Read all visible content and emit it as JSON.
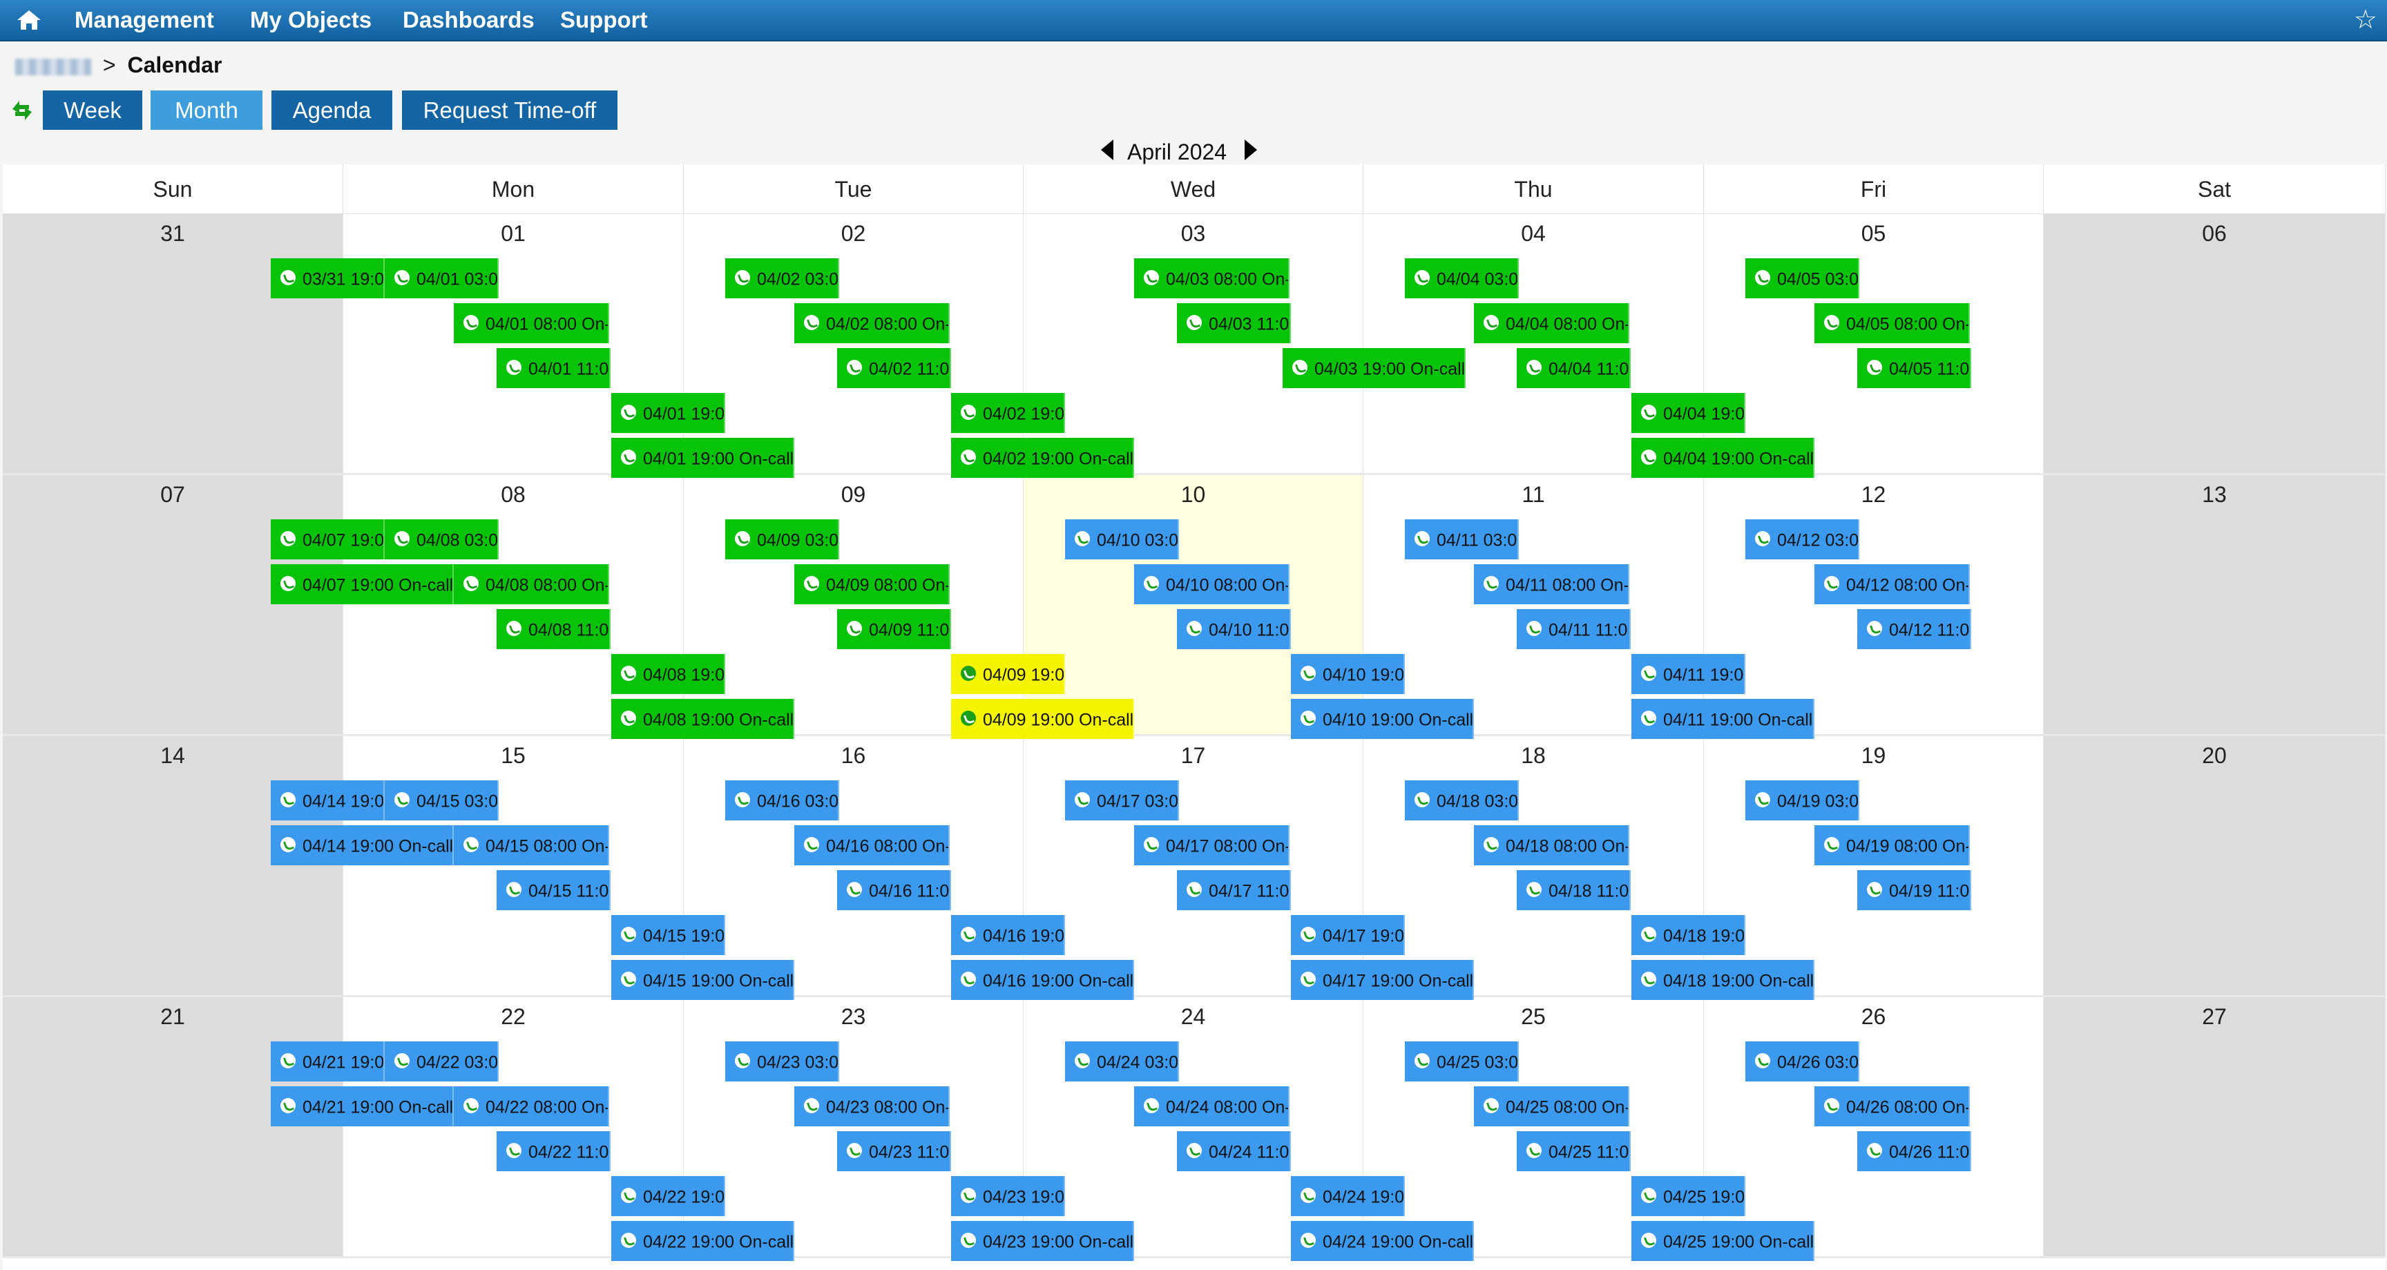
{
  "nav": {
    "items": [
      "Management",
      "My Objects",
      "Dashboards",
      "Support"
    ]
  },
  "breadcrumb": {
    "separator": ">",
    "current": "Calendar"
  },
  "views": {
    "buttons": [
      "Week",
      "Month",
      "Agenda",
      "Request Time-off"
    ],
    "active": "Month"
  },
  "month_nav": {
    "label": "April 2024"
  },
  "weekdays": [
    "Sun",
    "Mon",
    "Tue",
    "Wed",
    "Thu",
    "Fri",
    "Sat"
  ],
  "weeks": [
    [
      "31",
      "01",
      "02",
      "03",
      "04",
      "05",
      "06"
    ],
    [
      "07",
      "08",
      "09",
      "10",
      "11",
      "12",
      "13"
    ],
    [
      "14",
      "15",
      "16",
      "17",
      "18",
      "19",
      "20"
    ],
    [
      "21",
      "22",
      "23",
      "24",
      "25",
      "26",
      "27"
    ]
  ],
  "today": "10",
  "colors": {
    "green": "#08c408",
    "blue": "#3b99ee",
    "yellow": "#f4f400",
    "nav_blue": "#1565a4",
    "nav_active": "#3d9ddd"
  },
  "events": [
    {
      "w": 0,
      "d": 0,
      "r": 0,
      "label": "03/31 19:0",
      "color": "green"
    },
    {
      "w": 0,
      "d": 1,
      "r": 0,
      "label": "04/01 03:0",
      "color": "green"
    },
    {
      "w": 0,
      "d": 1,
      "r": 1,
      "label": "04/01 08:00 On-",
      "color": "green"
    },
    {
      "w": 0,
      "d": 1,
      "r": 2,
      "label": "04/01 11:0",
      "color": "green"
    },
    {
      "w": 0,
      "d": 2,
      "r": 3,
      "label": "04/01 19:0",
      "color": "green"
    },
    {
      "w": 0,
      "d": 2,
      "r": 4,
      "label": "04/01 19:00 On-call:",
      "color": "green"
    },
    {
      "w": 0,
      "d": 2,
      "r": 0,
      "label": "04/02 03:0",
      "color": "green"
    },
    {
      "w": 0,
      "d": 2,
      "r": 1,
      "label": "04/02 08:00 On-",
      "color": "green"
    },
    {
      "w": 0,
      "d": 2,
      "r": 2,
      "label": "04/02 11:0",
      "color": "green"
    },
    {
      "w": 0,
      "d": 3,
      "r": 3,
      "label": "04/02 19:0",
      "color": "green"
    },
    {
      "w": 0,
      "d": 3,
      "r": 4,
      "label": "04/02 19:00 On-call:",
      "color": "green"
    },
    {
      "w": 0,
      "d": 3,
      "r": 0,
      "label": "04/03 08:00 On-",
      "color": "green"
    },
    {
      "w": 0,
      "d": 3,
      "r": 1,
      "label": "04/03 11:0",
      "color": "green"
    },
    {
      "w": 0,
      "d": 3,
      "r": 2,
      "label": "04/03 19:00 On-call:",
      "color": "green"
    },
    {
      "w": 0,
      "d": 4,
      "r": 0,
      "label": "04/04 03:0",
      "color": "green"
    },
    {
      "w": 0,
      "d": 4,
      "r": 1,
      "label": "04/04 08:00 On-",
      "color": "green"
    },
    {
      "w": 0,
      "d": 4,
      "r": 2,
      "label": "04/04 11:0",
      "color": "green"
    },
    {
      "w": 0,
      "d": 5,
      "r": 3,
      "label": "04/04 19:0",
      "color": "green"
    },
    {
      "w": 0,
      "d": 5,
      "r": 4,
      "label": "04/04 19:00 On-call:",
      "color": "green"
    },
    {
      "w": 0,
      "d": 5,
      "r": 0,
      "label": "04/05 03:0",
      "color": "green"
    },
    {
      "w": 0,
      "d": 5,
      "r": 1,
      "label": "04/05 08:00 On-",
      "color": "green"
    },
    {
      "w": 0,
      "d": 5,
      "r": 2,
      "label": "04/05 11:0",
      "color": "green"
    },
    {
      "w": 1,
      "d": 0,
      "r": 0,
      "label": "04/07 19:0",
      "color": "green"
    },
    {
      "w": 1,
      "d": 0,
      "r": 1,
      "label": "04/07 19:00 On-call:",
      "color": "green"
    },
    {
      "w": 1,
      "d": 1,
      "r": 0,
      "label": "04/08 03:0",
      "color": "green"
    },
    {
      "w": 1,
      "d": 1,
      "r": 1,
      "label": "04/08 08:00 On-",
      "color": "green"
    },
    {
      "w": 1,
      "d": 1,
      "r": 2,
      "label": "04/08 11:0",
      "color": "green"
    },
    {
      "w": 1,
      "d": 2,
      "r": 3,
      "label": "04/08 19:0",
      "color": "green"
    },
    {
      "w": 1,
      "d": 2,
      "r": 4,
      "label": "04/08 19:00 On-call:",
      "color": "green"
    },
    {
      "w": 1,
      "d": 2,
      "r": 0,
      "label": "04/09 03:0",
      "color": "green"
    },
    {
      "w": 1,
      "d": 2,
      "r": 1,
      "label": "04/09 08:00 On-",
      "color": "green"
    },
    {
      "w": 1,
      "d": 2,
      "r": 2,
      "label": "04/09 11:0",
      "color": "green"
    },
    {
      "w": 1,
      "d": 3,
      "r": 3,
      "label": "04/09 19:0",
      "color": "yellow"
    },
    {
      "w": 1,
      "d": 3,
      "r": 4,
      "label": "04/09 19:00 On-call:",
      "color": "yellow"
    },
    {
      "w": 1,
      "d": 3,
      "r": 0,
      "label": "04/10 03:0",
      "color": "blue"
    },
    {
      "w": 1,
      "d": 3,
      "r": 1,
      "label": "04/10 08:00 On-",
      "color": "blue"
    },
    {
      "w": 1,
      "d": 3,
      "r": 2,
      "label": "04/10 11:0",
      "color": "blue"
    },
    {
      "w": 1,
      "d": 4,
      "r": 3,
      "label": "04/10 19:0",
      "color": "blue"
    },
    {
      "w": 1,
      "d": 4,
      "r": 4,
      "label": "04/10 19:00 On-call:",
      "color": "blue"
    },
    {
      "w": 1,
      "d": 4,
      "r": 0,
      "label": "04/11 03:0",
      "color": "blue"
    },
    {
      "w": 1,
      "d": 4,
      "r": 1,
      "label": "04/11 08:00 On-",
      "color": "blue"
    },
    {
      "w": 1,
      "d": 4,
      "r": 2,
      "label": "04/11 11:0",
      "color": "blue"
    },
    {
      "w": 1,
      "d": 5,
      "r": 3,
      "label": "04/11 19:0",
      "color": "blue"
    },
    {
      "w": 1,
      "d": 5,
      "r": 4,
      "label": "04/11 19:00 On-call:",
      "color": "blue"
    },
    {
      "w": 1,
      "d": 5,
      "r": 0,
      "label": "04/12 03:0",
      "color": "blue"
    },
    {
      "w": 1,
      "d": 5,
      "r": 1,
      "label": "04/12 08:00 On-",
      "color": "blue"
    },
    {
      "w": 1,
      "d": 5,
      "r": 2,
      "label": "04/12 11:0",
      "color": "blue"
    },
    {
      "w": 2,
      "d": 0,
      "r": 0,
      "label": "04/14 19:0",
      "color": "blue"
    },
    {
      "w": 2,
      "d": 0,
      "r": 1,
      "label": "04/14 19:00 On-call:",
      "color": "blue"
    },
    {
      "w": 2,
      "d": 1,
      "r": 0,
      "label": "04/15 03:0",
      "color": "blue"
    },
    {
      "w": 2,
      "d": 1,
      "r": 1,
      "label": "04/15 08:00 On-",
      "color": "blue"
    },
    {
      "w": 2,
      "d": 1,
      "r": 2,
      "label": "04/15 11:0",
      "color": "blue"
    },
    {
      "w": 2,
      "d": 2,
      "r": 3,
      "label": "04/15 19:0",
      "color": "blue"
    },
    {
      "w": 2,
      "d": 2,
      "r": 4,
      "label": "04/15 19:00 On-call:",
      "color": "blue"
    },
    {
      "w": 2,
      "d": 2,
      "r": 0,
      "label": "04/16 03:0",
      "color": "blue"
    },
    {
      "w": 2,
      "d": 2,
      "r": 1,
      "label": "04/16 08:00 On-",
      "color": "blue"
    },
    {
      "w": 2,
      "d": 2,
      "r": 2,
      "label": "04/16 11:0",
      "color": "blue"
    },
    {
      "w": 2,
      "d": 3,
      "r": 3,
      "label": "04/16 19:0",
      "color": "blue"
    },
    {
      "w": 2,
      "d": 3,
      "r": 4,
      "label": "04/16 19:00 On-call:",
      "color": "blue"
    },
    {
      "w": 2,
      "d": 3,
      "r": 0,
      "label": "04/17 03:0",
      "color": "blue"
    },
    {
      "w": 2,
      "d": 3,
      "r": 1,
      "label": "04/17 08:00 On-",
      "color": "blue"
    },
    {
      "w": 2,
      "d": 3,
      "r": 2,
      "label": "04/17 11:0",
      "color": "blue"
    },
    {
      "w": 2,
      "d": 4,
      "r": 3,
      "label": "04/17 19:0",
      "color": "blue"
    },
    {
      "w": 2,
      "d": 4,
      "r": 4,
      "label": "04/17 19:00 On-call:",
      "color": "blue"
    },
    {
      "w": 2,
      "d": 4,
      "r": 0,
      "label": "04/18 03:0",
      "color": "blue"
    },
    {
      "w": 2,
      "d": 4,
      "r": 1,
      "label": "04/18 08:00 On-",
      "color": "blue"
    },
    {
      "w": 2,
      "d": 4,
      "r": 2,
      "label": "04/18 11:0",
      "color": "blue"
    },
    {
      "w": 2,
      "d": 5,
      "r": 3,
      "label": "04/18 19:0",
      "color": "blue"
    },
    {
      "w": 2,
      "d": 5,
      "r": 4,
      "label": "04/18 19:00 On-call:",
      "color": "blue"
    },
    {
      "w": 2,
      "d": 5,
      "r": 0,
      "label": "04/19 03:0",
      "color": "blue"
    },
    {
      "w": 2,
      "d": 5,
      "r": 1,
      "label": "04/19 08:00 On-",
      "color": "blue"
    },
    {
      "w": 2,
      "d": 5,
      "r": 2,
      "label": "04/19 11:0",
      "color": "blue"
    },
    {
      "w": 3,
      "d": 0,
      "r": 0,
      "label": "04/21 19:0",
      "color": "blue"
    },
    {
      "w": 3,
      "d": 0,
      "r": 1,
      "label": "04/21 19:00 On-call:",
      "color": "blue"
    },
    {
      "w": 3,
      "d": 1,
      "r": 0,
      "label": "04/22 03:0",
      "color": "blue"
    },
    {
      "w": 3,
      "d": 1,
      "r": 1,
      "label": "04/22 08:00 On-",
      "color": "blue"
    },
    {
      "w": 3,
      "d": 1,
      "r": 2,
      "label": "04/22 11:0",
      "color": "blue"
    },
    {
      "w": 3,
      "d": 2,
      "r": 3,
      "label": "04/22 19:0",
      "color": "blue"
    },
    {
      "w": 3,
      "d": 2,
      "r": 4,
      "label": "04/22 19:00 On-call:",
      "color": "blue"
    },
    {
      "w": 3,
      "d": 2,
      "r": 0,
      "label": "04/23 03:0",
      "color": "blue"
    },
    {
      "w": 3,
      "d": 2,
      "r": 1,
      "label": "04/23 08:00 On-",
      "color": "blue"
    },
    {
      "w": 3,
      "d": 2,
      "r": 2,
      "label": "04/23 11:0",
      "color": "blue"
    },
    {
      "w": 3,
      "d": 3,
      "r": 3,
      "label": "04/23 19:0",
      "color": "blue"
    },
    {
      "w": 3,
      "d": 3,
      "r": 4,
      "label": "04/23 19:00 On-call:",
      "color": "blue"
    },
    {
      "w": 3,
      "d": 3,
      "r": 0,
      "label": "04/24 03:0",
      "color": "blue"
    },
    {
      "w": 3,
      "d": 3,
      "r": 1,
      "label": "04/24 08:00 On-",
      "color": "blue"
    },
    {
      "w": 3,
      "d": 3,
      "r": 2,
      "label": "04/24 11:0",
      "color": "blue"
    },
    {
      "w": 3,
      "d": 4,
      "r": 3,
      "label": "04/24 19:0",
      "color": "blue"
    },
    {
      "w": 3,
      "d": 4,
      "r": 4,
      "label": "04/24 19:00 On-call:",
      "color": "blue"
    },
    {
      "w": 3,
      "d": 4,
      "r": 0,
      "label": "04/25 03:0",
      "color": "blue"
    },
    {
      "w": 3,
      "d": 4,
      "r": 1,
      "label": "04/25 08:00 On-",
      "color": "blue"
    },
    {
      "w": 3,
      "d": 4,
      "r": 2,
      "label": "04/25 11:0",
      "color": "blue"
    },
    {
      "w": 3,
      "d": 5,
      "r": 3,
      "label": "04/25 19:0",
      "color": "blue"
    },
    {
      "w": 3,
      "d": 5,
      "r": 4,
      "label": "04/25 19:00 On-call:",
      "color": "blue"
    },
    {
      "w": 3,
      "d": 5,
      "r": 0,
      "label": "04/26 03:0",
      "color": "blue"
    },
    {
      "w": 3,
      "d": 5,
      "r": 1,
      "label": "04/26 08:00 On-",
      "color": "blue"
    },
    {
      "w": 3,
      "d": 5,
      "r": 2,
      "label": "04/26 11:0",
      "color": "blue"
    }
  ]
}
